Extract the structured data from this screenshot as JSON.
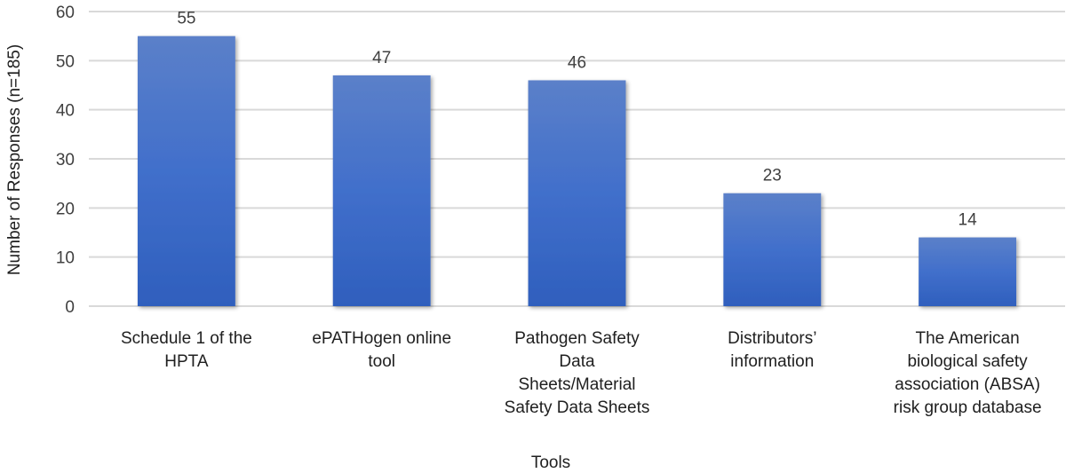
{
  "chart_data": {
    "type": "bar",
    "title": "",
    "xlabel": "Tools",
    "ylabel": "Number of Responses (n=185)",
    "ylim": [
      0,
      60
    ],
    "yticks": [
      0,
      10,
      20,
      30,
      40,
      50,
      60
    ],
    "grid": true,
    "legend": "none",
    "categories": [
      [
        "Schedule 1 of the",
        "HPTA"
      ],
      [
        "ePATHogen online",
        "tool"
      ],
      [
        "Pathogen Safety",
        "Data",
        "Sheets/Material",
        "Safety Data Sheets"
      ],
      [
        "Distributors’",
        "information"
      ],
      [
        "The American",
        "biological safety",
        "association (ABSA)",
        "risk group database"
      ]
    ],
    "values": [
      55,
      47,
      46,
      23,
      14
    ],
    "data_labels": [
      "55",
      "47",
      "46",
      "23",
      "14"
    ],
    "colors": {
      "bar_top": "#5b80c9",
      "bar_bottom": "#2f5fbd",
      "grid": "#d9d9d9",
      "text": "#404040"
    }
  }
}
